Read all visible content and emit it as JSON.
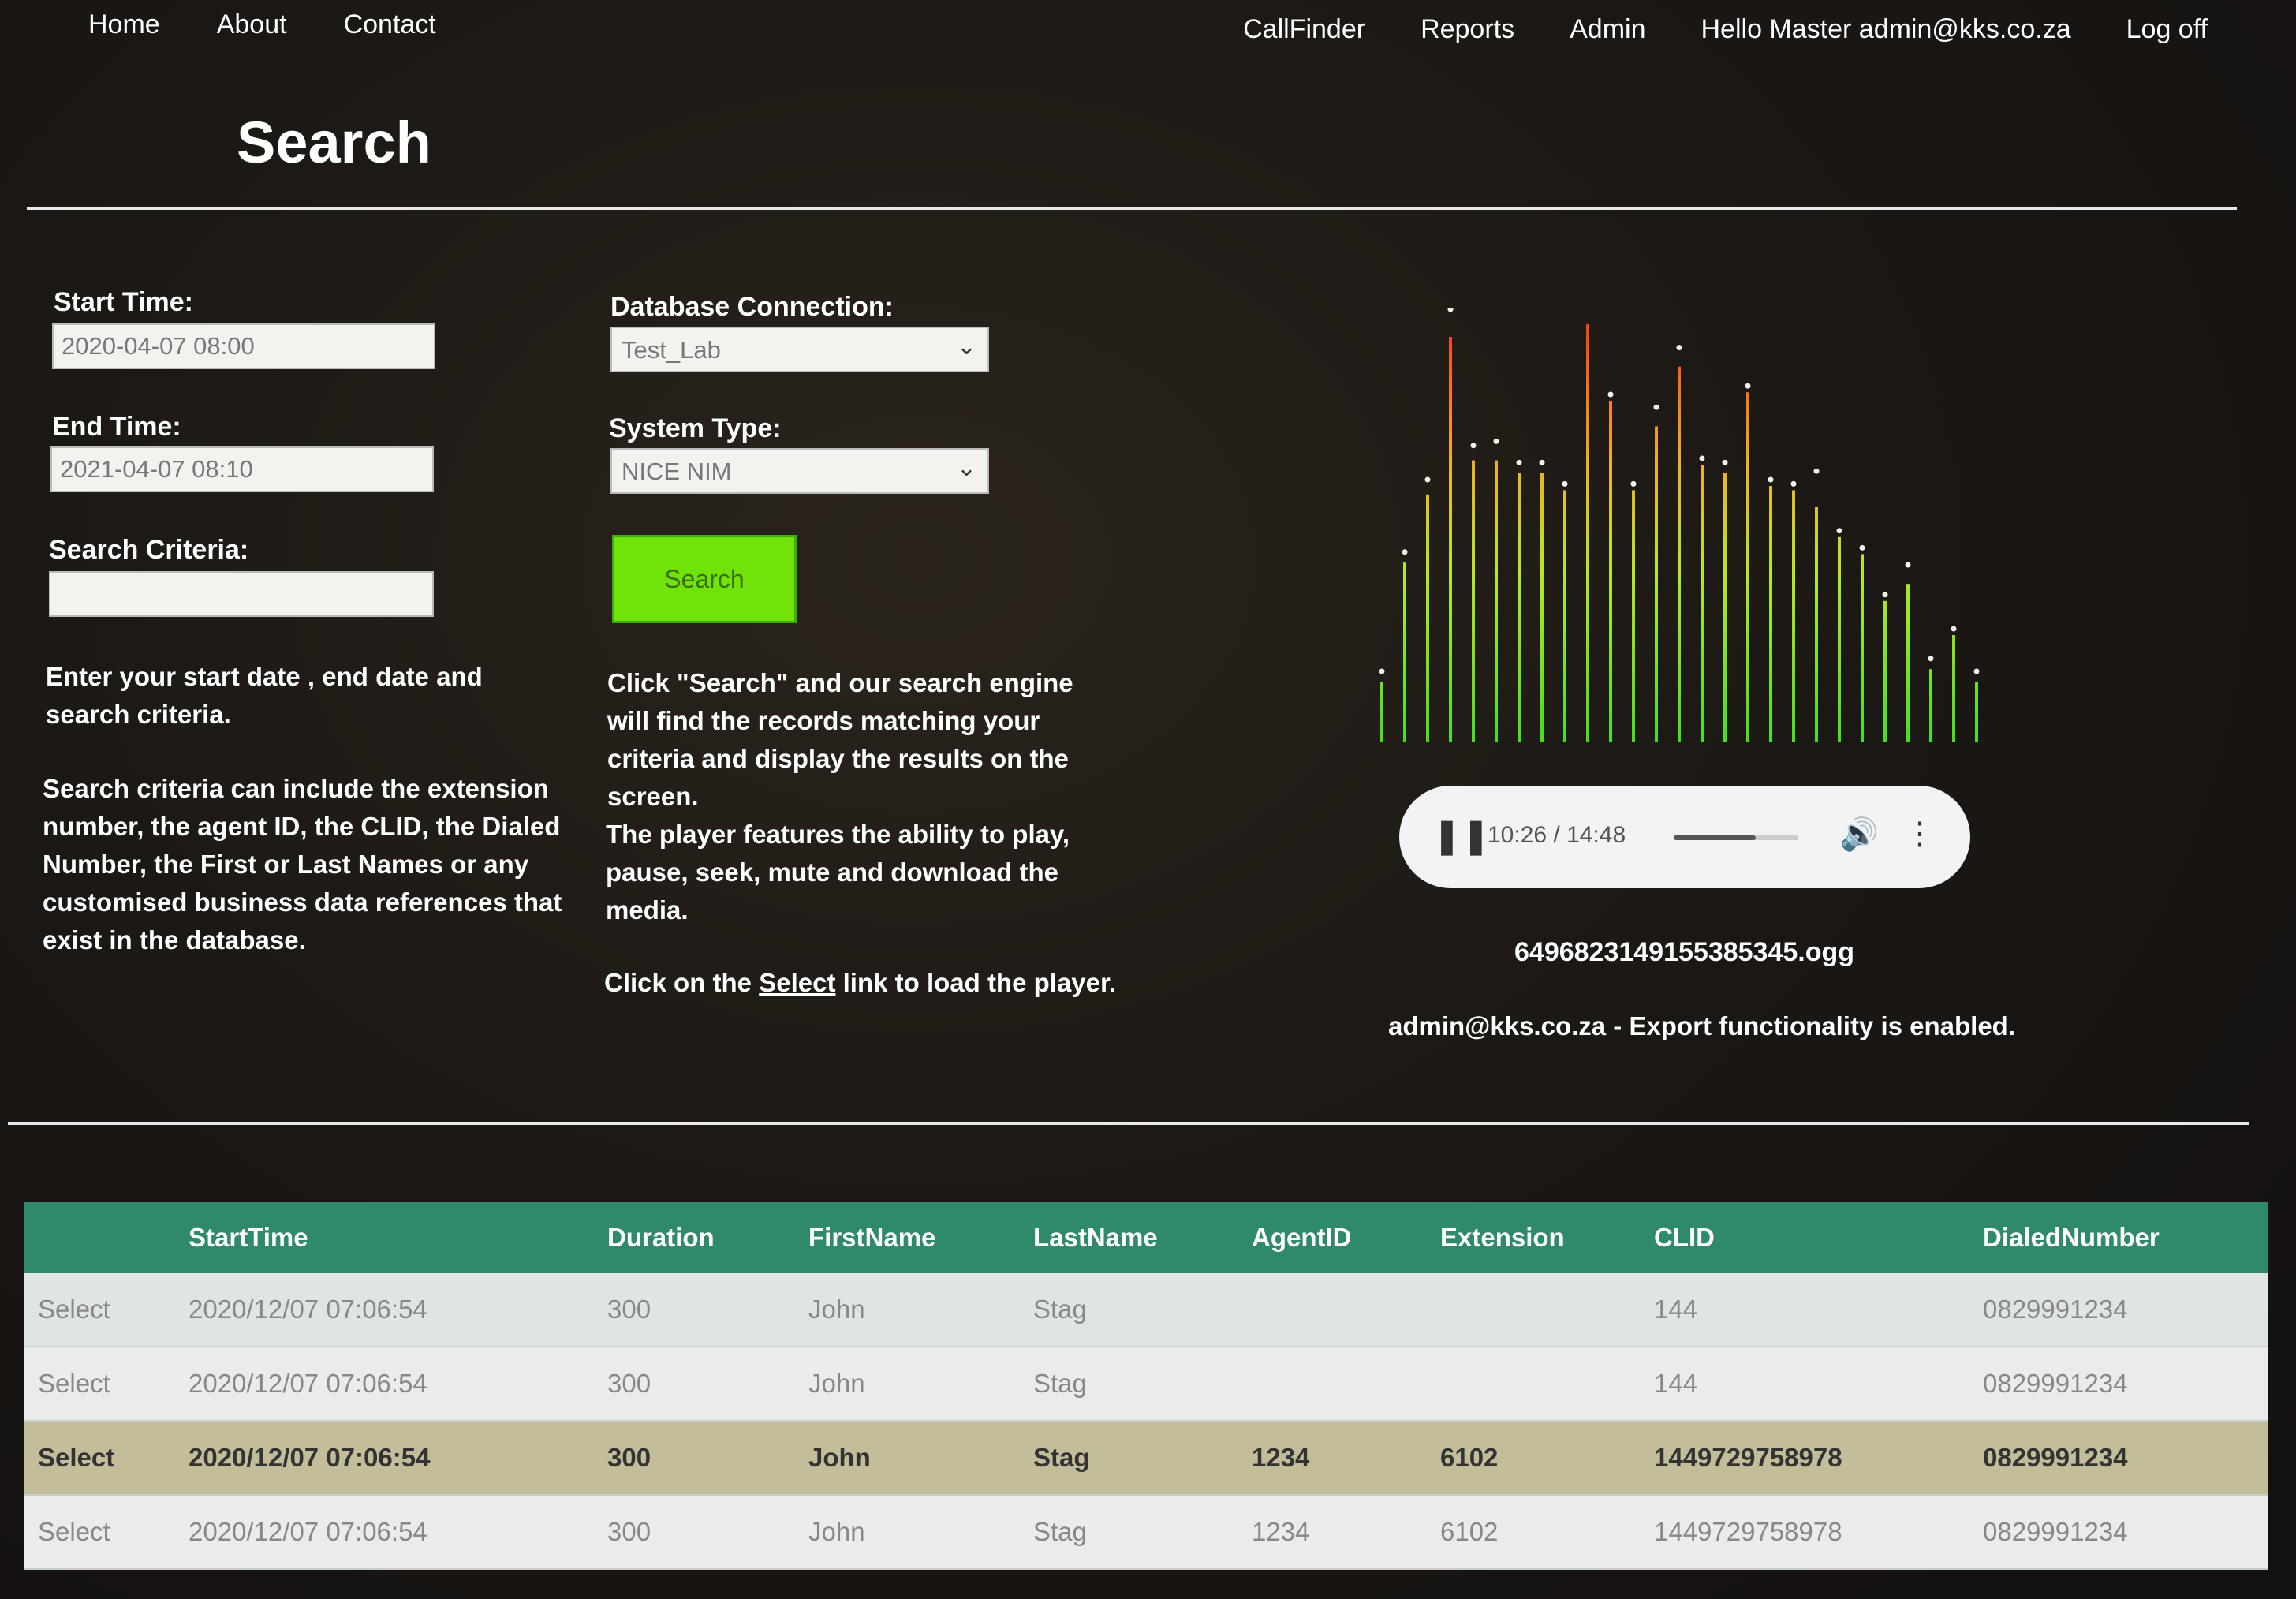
{
  "nav": {
    "left": [
      "Home",
      "About",
      "Contact"
    ],
    "right": [
      "CallFinder",
      "Reports",
      "Admin",
      "Hello Master admin@kks.co.za",
      "Log off"
    ]
  },
  "page_title": "Search",
  "form": {
    "start_label": "Start Time:",
    "start_value": "2020-04-07 08:00",
    "end_label": "End Time:",
    "end_value": "2021-04-07 08:10",
    "criteria_label": "Search Criteria:",
    "criteria_value": "",
    "db_label": "Database Connection:",
    "db_value": "Test_Lab",
    "system_label": "System Type:",
    "system_value": "NICE NIM",
    "search_button": "Search"
  },
  "help": {
    "left_p1": "Enter your start date , end date and search criteria.",
    "left_p2": "Search criteria can include the extension number, the agent ID, the CLID, the Dialed Number, the First or Last Names or any customised business data references that exist in the database.",
    "mid_p1": "Click \"Search\" and our search engine will find the records matching your criteria and display the results on the screen.",
    "mid_p2": "The player features the ability to play, pause, seek, mute and download the media.",
    "mid_p3_prefix": "Click on the ",
    "mid_p3_link": "Select",
    "mid_p3_suffix": " link to load the player."
  },
  "visualizer": {
    "bar_levels": [
      0.14,
      0.42,
      0.58,
      0.95,
      0.66,
      0.66,
      0.63,
      0.63,
      0.59,
      0.98,
      0.8,
      0.59,
      0.74,
      0.88,
      0.65,
      0.63,
      0.82,
      0.6,
      0.59,
      0.55,
      0.48,
      0.44,
      0.33,
      0.37,
      0.17,
      0.25,
      0.14
    ],
    "peak_levels": [
      0.15,
      0.43,
      0.6,
      1.0,
      0.68,
      0.69,
      0.64,
      0.64,
      0.59,
      1.02,
      0.8,
      0.59,
      0.77,
      0.91,
      0.65,
      0.64,
      0.82,
      0.6,
      0.59,
      0.62,
      0.48,
      0.44,
      0.33,
      0.4,
      0.18,
      0.25,
      0.15
    ]
  },
  "player": {
    "time": "10:26 / 14:48",
    "progress": 0.66
  },
  "media_file": "6496823149155385345.ogg",
  "export_message": "admin@kks.co.za - Export functionality is enabled.",
  "table": {
    "headers": [
      "",
      "StartTime",
      "Duration",
      "FirstName",
      "LastName",
      "AgentID",
      "Extension",
      "CLID",
      "DialedNumber"
    ],
    "rows": [
      [
        "Select",
        "2020/12/07 07:06:54",
        "300",
        "John",
        "Stag",
        "",
        "",
        "144",
        "0829991234"
      ],
      [
        "Select",
        "2020/12/07 07:06:54",
        "300",
        "John",
        "Stag",
        "",
        "",
        "144",
        "0829991234"
      ],
      [
        "Select",
        "2020/12/07 07:06:54",
        "300",
        "John",
        "Stag",
        "1234",
        "6102",
        "1449729758978",
        "0829991234"
      ],
      [
        "Select",
        "2020/12/07 07:06:54",
        "300",
        "John",
        "Stag",
        "1234",
        "6102",
        "1449729758978",
        "0829991234"
      ]
    ],
    "selected_row": 2
  }
}
